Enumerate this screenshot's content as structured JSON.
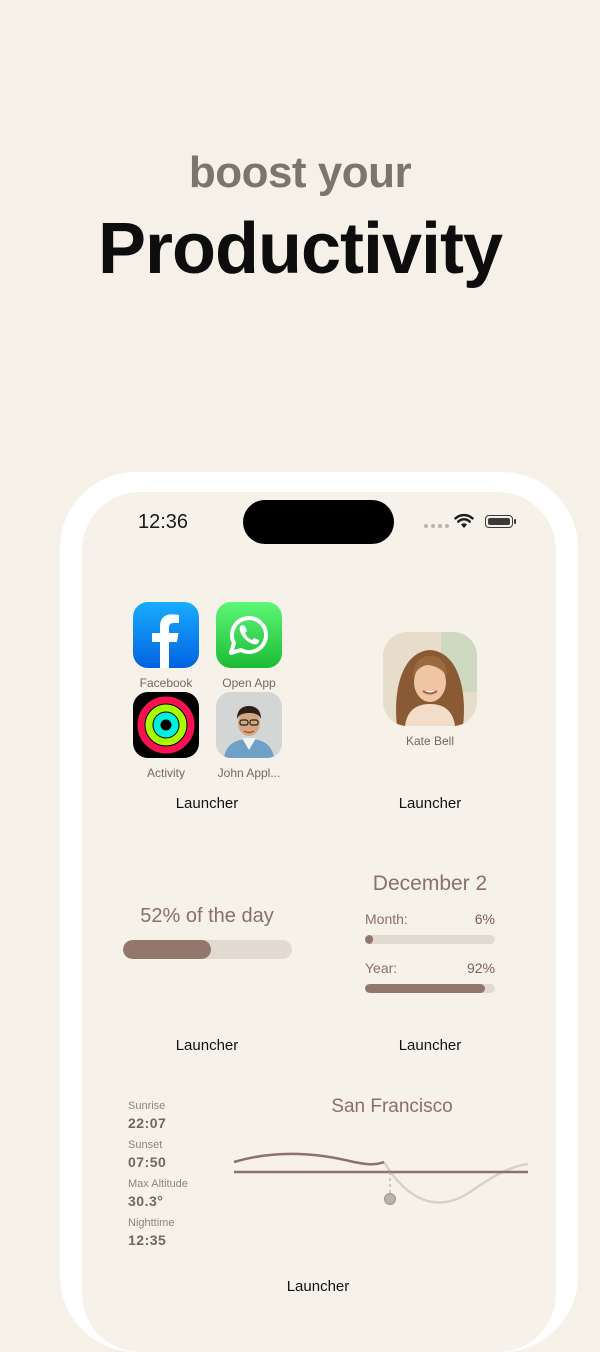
{
  "hero": {
    "line1": "boost your",
    "line2": "Productivity"
  },
  "status_bar": {
    "time": "12:36"
  },
  "apps": [
    {
      "label": "Facebook",
      "icon": "facebook-icon"
    },
    {
      "label": "Open App",
      "icon": "whatsapp-icon"
    },
    {
      "label": "Activity",
      "icon": "activity-rings-icon"
    },
    {
      "label": "John Appl...",
      "icon": "contact-photo-john"
    }
  ],
  "contact": {
    "name": "Kate Bell",
    "icon": "contact-photo-kate"
  },
  "widgets": {
    "launcher_label": "Launcher",
    "day_progress": {
      "text": "52% of the day",
      "fraction": 0.52
    },
    "date_progress": {
      "title": "December 2",
      "month_label": "Month:",
      "month_value": "6%",
      "month_fraction": 0.06,
      "year_label": "Year:",
      "year_value": "92%",
      "year_fraction": 0.92
    },
    "sun": {
      "city": "San Francisco",
      "sunrise_label": "Sunrise",
      "sunrise_value": "22:07",
      "sunset_label": "Sunset",
      "sunset_value": "07:50",
      "altitude_label": "Max Altitude",
      "altitude_value": "30.3°",
      "night_label": "Nighttime",
      "night_value": "12:35"
    }
  },
  "colors": {
    "accent": "#94776c",
    "track": "#e2dad1",
    "background": "#f5f1e9"
  }
}
